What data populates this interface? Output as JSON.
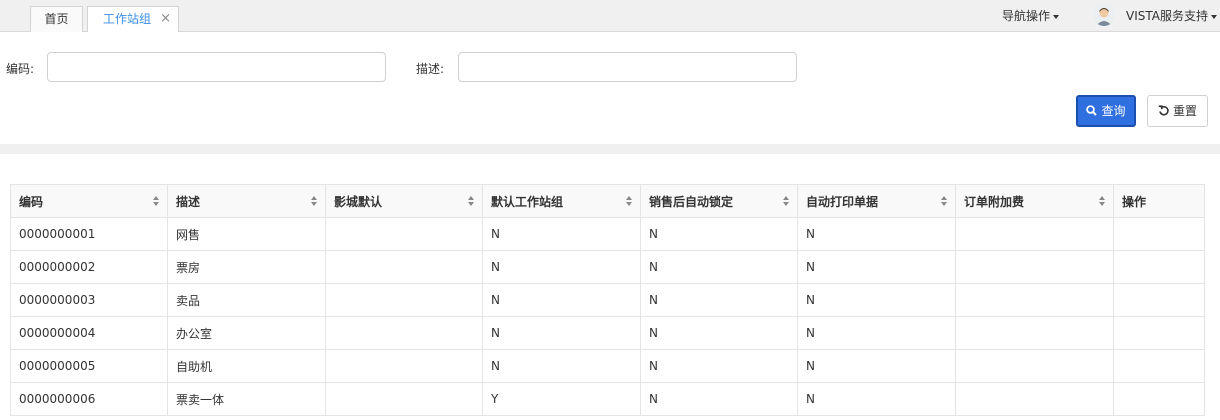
{
  "tabs": [
    {
      "label": "首页"
    },
    {
      "label": "工作站组",
      "close": "×"
    }
  ],
  "header": {
    "nav_ops": "导航操作",
    "user": "VISTA服务支持"
  },
  "search": {
    "code_label": "编码:",
    "desc_label": "描述:",
    "code_value": "",
    "desc_value": "",
    "query_button": "查询",
    "reset_button": "重置"
  },
  "table": {
    "columns": [
      "编码",
      "描述",
      "影城默认",
      "默认工作站组",
      "销售后自动锁定",
      "自动打印单据",
      "订单附加费",
      "操作"
    ],
    "rows": [
      [
        "0000000001",
        "网售",
        "",
        "N",
        "N",
        "N",
        "",
        ""
      ],
      [
        "0000000002",
        "票房",
        "",
        "N",
        "N",
        "N",
        "",
        ""
      ],
      [
        "0000000003",
        "卖品",
        "",
        "N",
        "N",
        "N",
        "",
        ""
      ],
      [
        "0000000004",
        "办公室",
        "",
        "N",
        "N",
        "N",
        "",
        ""
      ],
      [
        "0000000005",
        "自助机",
        "",
        "N",
        "N",
        "N",
        "",
        ""
      ],
      [
        "0000000006",
        "票卖一体",
        "",
        "Y",
        "N",
        "N",
        "",
        ""
      ]
    ]
  },
  "colors": {
    "accent": "#2f6fe0",
    "active_tab_text": "#3a8ee6",
    "divider": "#f0f0f0"
  },
  "icons": {
    "query": "search-icon",
    "reset": "undo-icon",
    "tab_close": "close-icon",
    "sort": "sort-icon"
  }
}
